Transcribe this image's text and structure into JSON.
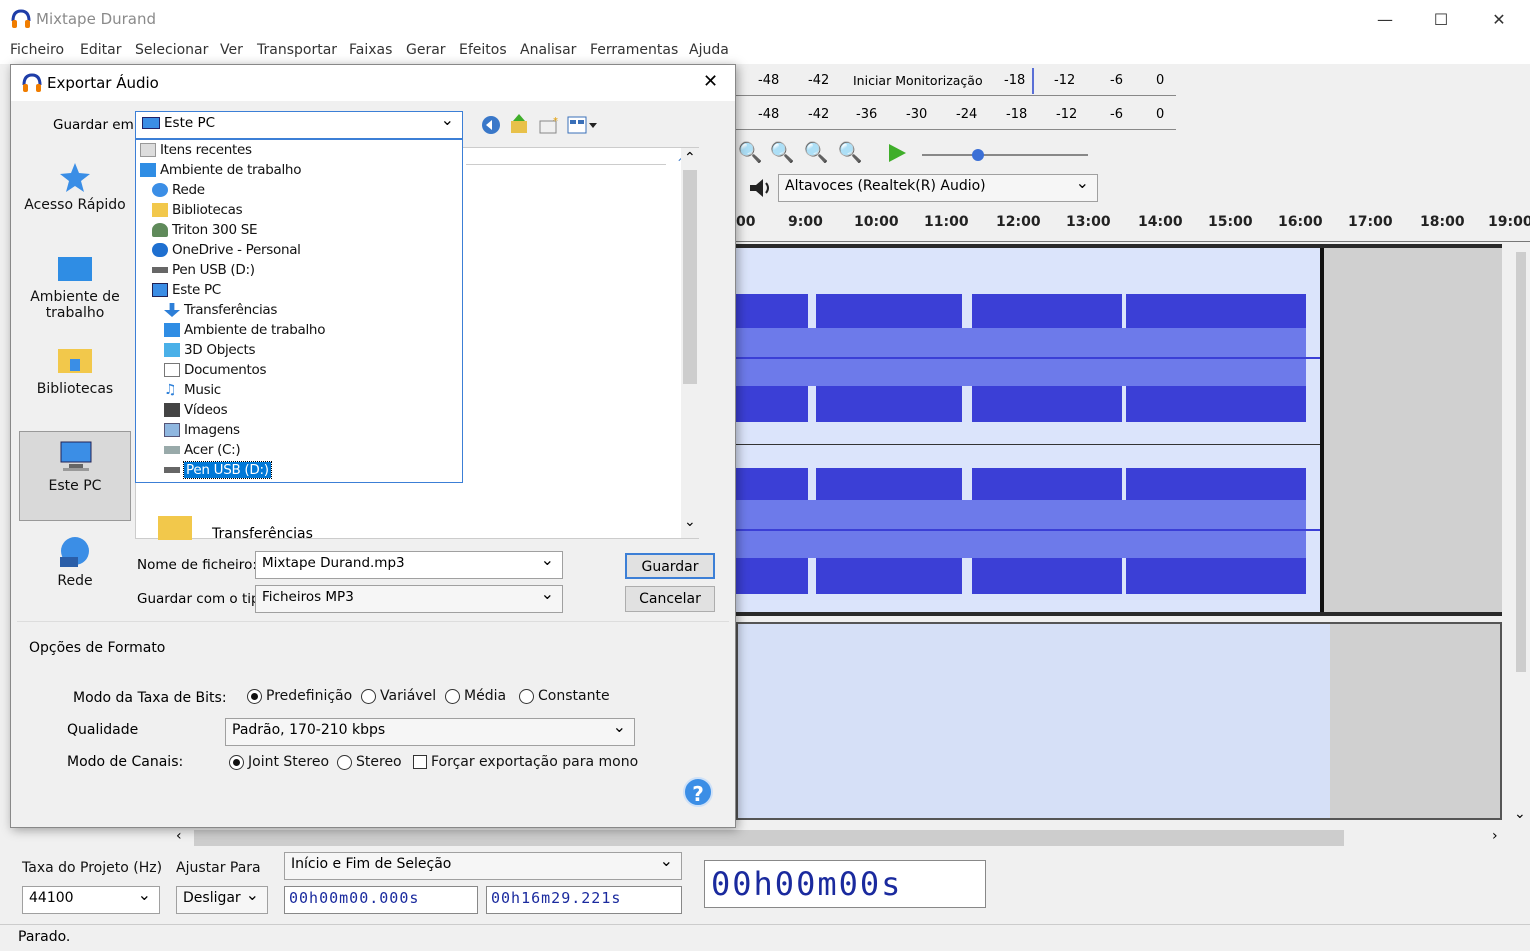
{
  "app": {
    "title": "Mixtape Durand",
    "minimize": "—",
    "maximize": "☐",
    "close": "✕"
  },
  "menu": [
    "Ficheiro",
    "Editar",
    "Selecionar",
    "Ver",
    "Transportar",
    "Faixas",
    "Gerar",
    "Efeitos",
    "Analisar",
    "Ferramentas",
    "Ajuda"
  ],
  "meters": {
    "rec_ticks": [
      "-48",
      "-42",
      "Iniciar Monitorização",
      "-18",
      "-12",
      "-6",
      "0"
    ],
    "play_ticks": [
      "-48",
      "-42",
      "-36",
      "-30",
      "-24",
      "-18",
      "-12",
      "-6",
      "0"
    ]
  },
  "device": {
    "output": "Altavoces (Realtek(R) Audio)"
  },
  "ruler": [
    "00",
    "9:00",
    "10:00",
    "11:00",
    "12:00",
    "13:00",
    "14:00",
    "15:00",
    "16:00",
    "17:00",
    "18:00",
    "19:00"
  ],
  "selection": {
    "rate_label": "Taxa do Projeto (Hz)",
    "rate_value": "44100",
    "snap_label": "Ajustar Para",
    "snap_value": "Desligar",
    "mode": "Início e Fim de Seleção",
    "start": "00h00m00.000s",
    "end": "00h16m29.221s",
    "position": "00h00m00s"
  },
  "status": "Parado.",
  "colors": {
    "wave": "#3b3fd6",
    "wave_rms": "#6d7aea",
    "clip_bg": "#dbe4fb",
    "selection_blue": "#1a2a9e"
  },
  "dialog": {
    "title": "Exportar Áudio",
    "close": "✕",
    "save_in_label": "Guardar em:",
    "save_in_value": "Este PC",
    "places": [
      {
        "label": "Acesso Rápido",
        "icon": "star-icon"
      },
      {
        "label": "Ambiente de trabalho",
        "icon": "desktop-icon"
      },
      {
        "label": "Bibliotecas",
        "icon": "library-icon"
      },
      {
        "label": "Este PC",
        "icon": "pc-icon"
      },
      {
        "label": "Rede",
        "icon": "network-icon"
      }
    ],
    "dropdown": [
      {
        "label": "Itens recentes",
        "indent": 0
      },
      {
        "label": "Ambiente de trabalho",
        "indent": 0
      },
      {
        "label": "Rede",
        "indent": 1
      },
      {
        "label": "Bibliotecas",
        "indent": 1
      },
      {
        "label": "Triton 300 SE",
        "indent": 1
      },
      {
        "label": "OneDrive - Personal",
        "indent": 1
      },
      {
        "label": "Pen USB (D:)",
        "indent": 1
      },
      {
        "label": "Este PC",
        "indent": 1
      },
      {
        "label": "Transferências",
        "indent": 2
      },
      {
        "label": "Ambiente de trabalho",
        "indent": 2
      },
      {
        "label": "3D Objects",
        "indent": 2
      },
      {
        "label": "Documentos",
        "indent": 2
      },
      {
        "label": "Music",
        "indent": 2
      },
      {
        "label": "Vídeos",
        "indent": 2
      },
      {
        "label": "Imagens",
        "indent": 2
      },
      {
        "label": "Acer (C:)",
        "indent": 2
      },
      {
        "label": "Pen USB (D:)",
        "indent": 2,
        "selected": true
      }
    ],
    "background_item": "Transferências",
    "filename_label": "Nome de ficheiro:",
    "filename_value": "Mixtape Durand.mp3",
    "type_label": "Guardar com o tipo:",
    "type_value": "Ficheiros MP3",
    "save_button": "Guardar",
    "cancel_button": "Cancelar",
    "format_group": "Opções de Formato",
    "bitrate_label": "Modo da Taxa de Bits:",
    "bitrate_options": [
      "Predefinição",
      "Variável",
      "Média",
      "Constante"
    ],
    "quality_label": "Qualidade",
    "quality_value": "Padrão, 170-210 kbps",
    "channel_label": "Modo de Canais:",
    "channel_options": [
      "Joint Stereo",
      "Stereo"
    ],
    "force_mono": "Forçar exportação para mono",
    "help": "?"
  }
}
